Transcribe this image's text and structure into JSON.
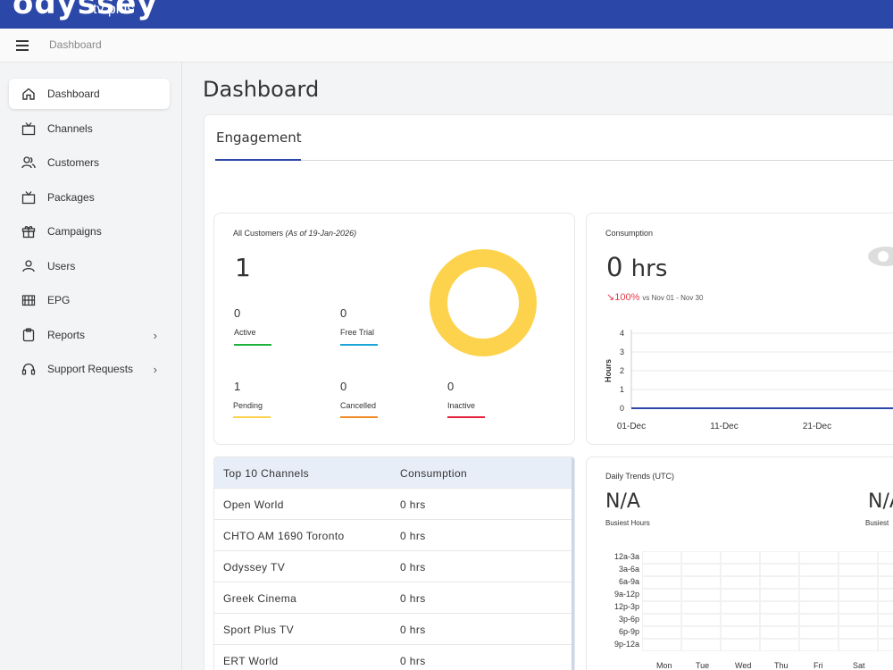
{
  "header": {
    "logo": "odyssey",
    "logo_sub": "tv plus",
    "breadcrumb": "Dashboard"
  },
  "sidebar": {
    "items": [
      {
        "label": "Dashboard",
        "icon": "home-icon",
        "active": true
      },
      {
        "label": "Channels",
        "icon": "tv-icon"
      },
      {
        "label": "Customers",
        "icon": "users-icon"
      },
      {
        "label": "Packages",
        "icon": "tv-icon"
      },
      {
        "label": "Campaigns",
        "icon": "gift-icon"
      },
      {
        "label": "Users",
        "icon": "user-icon"
      },
      {
        "label": "EPG",
        "icon": "book-icon"
      },
      {
        "label": "Reports",
        "icon": "clipboard-icon",
        "chevron": "›"
      },
      {
        "label": "Support Requests",
        "icon": "headset-icon",
        "chevron": "›"
      }
    ]
  },
  "main": {
    "title": "Dashboard",
    "tab": "Engagement",
    "customers": {
      "label": "All Customers",
      "as_of": "(As of 19-Jan-2026)",
      "total": "1",
      "stats": [
        {
          "value": "0",
          "label": "Active",
          "color": "#1bb33b"
        },
        {
          "value": "0",
          "label": "Free Trial",
          "color": "#1aa5d8"
        },
        {
          "value": "1",
          "label": "Pending",
          "color": "#fdd34d"
        },
        {
          "value": "0",
          "label": "Cancelled",
          "color": "#f08a24"
        },
        {
          "value": "0",
          "label": "Inactive",
          "color": "#e3213f"
        }
      ]
    },
    "consumption": {
      "label": "Consumption",
      "value": "0",
      "unit": "hrs",
      "delta": "↘100%",
      "delta_context": "vs Nov 01 - Nov 30"
    },
    "top_channels": {
      "headers": [
        "Top 10 Channels",
        "Consumption"
      ],
      "rows": [
        [
          "Open World",
          "0 hrs"
        ],
        [
          "CHTO AM 1690 Toronto",
          "0 hrs"
        ],
        [
          "Odyssey TV",
          "0 hrs"
        ],
        [
          "Greek Cinema",
          "0 hrs"
        ],
        [
          "Sport Plus TV",
          "0 hrs"
        ],
        [
          "ERT World",
          "0 hrs"
        ]
      ]
    },
    "daily_trends": {
      "label": "Daily Trends (UTC)",
      "busiest_hours_value": "N/A",
      "busiest_hours_label": "Busiest Hours",
      "busiest_day_value": "N/A",
      "busiest_day_label": "Busiest",
      "time_slots": [
        "12a-3a",
        "3a-6a",
        "6a-9a",
        "9a-12p",
        "12p-3p",
        "3p-6p",
        "6p-9p",
        "9p-12a"
      ],
      "days": [
        "Mon",
        "Tue",
        "Wed",
        "Thu",
        "Fri",
        "Sat"
      ]
    }
  },
  "chart_data": {
    "type": "line",
    "title": "",
    "xlabel": "",
    "ylabel": "Hours",
    "x_ticks": [
      "01-Dec",
      "11-Dec",
      "21-Dec"
    ],
    "y_ticks": [
      "0",
      "1",
      "2",
      "3",
      "4"
    ],
    "ylim": [
      0,
      4
    ],
    "series": [
      {
        "values": [
          0,
          0,
          0,
          0
        ]
      }
    ],
    "line_color": "#2b47a8"
  }
}
